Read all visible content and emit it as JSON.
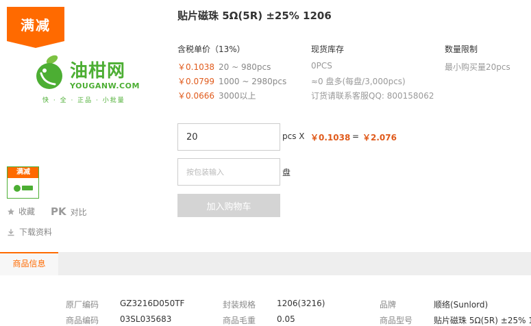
{
  "promo": {
    "tag": "满减",
    "thumb_tag": "满减"
  },
  "logo": {
    "cn": "油柑网",
    "en": "YOUGANW.COM",
    "slogan": "快 · 全 · 正品 · 小批量"
  },
  "actions": {
    "favorite": "收藏",
    "pk_mark": "PK",
    "compare": "对比",
    "download": "下载资料"
  },
  "product": {
    "title": "贴片磁珠 5Ω(5R) ±25% 1206"
  },
  "columns": {
    "price": "含税单价（13%）",
    "stock": "现货库存",
    "limit": "数量限制"
  },
  "prices": [
    {
      "price": "￥0.1038",
      "range": "20 ~ 980pcs"
    },
    {
      "price": "￥0.0799",
      "range": "1000 ~ 2980pcs"
    },
    {
      "price": "￥0.0666",
      "range": "3000以上"
    }
  ],
  "stock": {
    "qty": "0PCS",
    "reels": "≈0 盘多(每盘/3,000pcs)",
    "contact": "订货请联系客服QQ: 800158062"
  },
  "limit": {
    "min": "最小购买量20pcs"
  },
  "order": {
    "qty_value": "20",
    "unit": "pcs X",
    "unit_price": "￥0.1038",
    "eq": "=",
    "total": "￥2.076",
    "pkg_placeholder": "按包装输入",
    "pkg_unit": "盘",
    "cart_button": "加入购物车"
  },
  "tabs": {
    "active": "商品信息"
  },
  "specs": [
    {
      "k1": "原厂编码",
      "v1": "GZ3216D050TF",
      "k2": "封装规格",
      "v2": "1206(3216)",
      "k3": "品牌",
      "v3": "顺络(Sunlord)"
    },
    {
      "k1": "商品编码",
      "v1": "03SL035683",
      "k2": "商品毛重",
      "v2": "0.05",
      "k3": "商品型号",
      "v3": "贴片磁珠 5Ω(5R) ±25% 1"
    }
  ],
  "colors": {
    "accent": "#ff6a00",
    "price": "#e05a1b",
    "brand_green": "#4cae33"
  }
}
